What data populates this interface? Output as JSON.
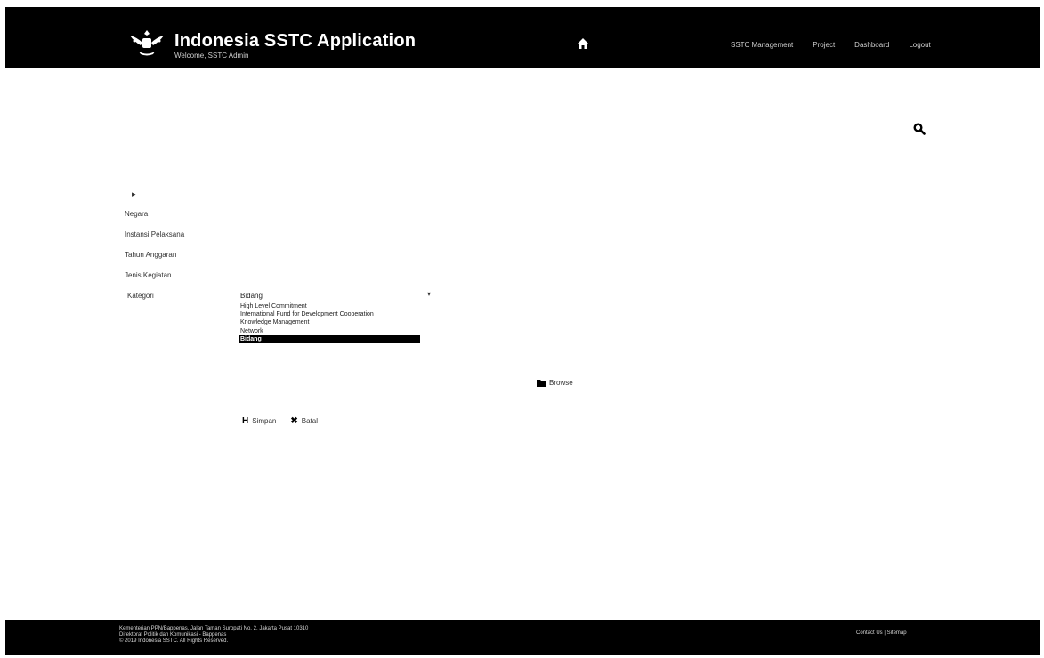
{
  "header": {
    "title": "Indonesia SSTC Application",
    "subtitle": "Welcome, SSTC Admin",
    "logo_icon": "garuda-emblem-icon",
    "home_icon": "home-icon",
    "nav": [
      "SSTC Management",
      "Project",
      "Dashboard",
      "Logout"
    ]
  },
  "search": {
    "icon": "search-icon"
  },
  "sidebar": {
    "arrow": "▸",
    "items": [
      "Negara",
      "Instansi Pelaksana",
      "Tahun Anggaran",
      "Jenis Kegiatan"
    ]
  },
  "form": {
    "field_label": "Kategori",
    "selected_value": "Bidang",
    "options": [
      "High Level Commitment",
      "International Fund for Development Cooperation",
      "Knowledge Management",
      "Network",
      "Bidang"
    ],
    "browse_label": "Browse",
    "save_label": "Simpan",
    "cancel_label": "Batal"
  },
  "footer": {
    "lines": [
      "Kementerian PPN/Bappenas, Jalan Taman Suropati No. 2, Jakarta Pusat 10310",
      "Direktorat Politik dan Komunikasi - Bappenas",
      "© 2019 Indonesia SSTC. All Rights Reserved."
    ],
    "right": "Contact Us | Sitemap"
  },
  "colors": {
    "bar": "#000000",
    "page": "#ffffff",
    "selected": "#000000"
  }
}
